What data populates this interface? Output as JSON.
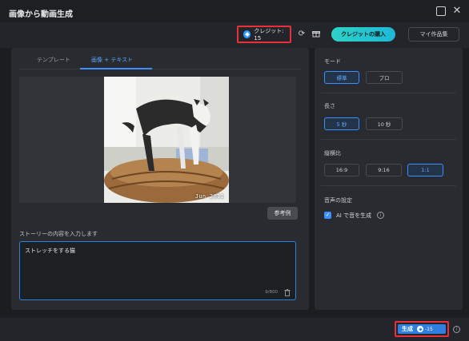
{
  "window": {
    "title": "画像から動画生成"
  },
  "toolbar": {
    "credits_label": "クレジット: 15",
    "buy_label": "クレジットの購入",
    "my_works_label": "マイ作品集"
  },
  "left": {
    "tabs": [
      {
        "label": "テンプレート",
        "active": false
      },
      {
        "label": "画像 + テキスト",
        "active": true
      }
    ],
    "image": {
      "date_stamp": "Jun 2011"
    },
    "example_label": "参考例",
    "story_label": "ストーリーの内容を入力します",
    "story_value": "ストレッチをする猫",
    "story_count": "9/800"
  },
  "right": {
    "mode": {
      "label": "モード",
      "options": [
        "標準",
        "プロ"
      ],
      "selected": "標準"
    },
    "length": {
      "label": "長さ",
      "options": [
        "5 秒",
        "10 秒"
      ],
      "selected": "5 秒"
    },
    "aspect": {
      "label": "縦横比",
      "options": [
        "16:9",
        "9:16",
        "1:1"
      ],
      "selected": "1:1"
    },
    "audio": {
      "label": "音声の設定",
      "checkbox_label": "AI で音を生成",
      "checked": true
    }
  },
  "footer": {
    "generate_label": "生成",
    "generate_cost": "-15"
  },
  "colors": {
    "accent": "#3b8fff",
    "buy_gradient_start": "#2ed3c6",
    "highlight_border": "#e8303a"
  }
}
